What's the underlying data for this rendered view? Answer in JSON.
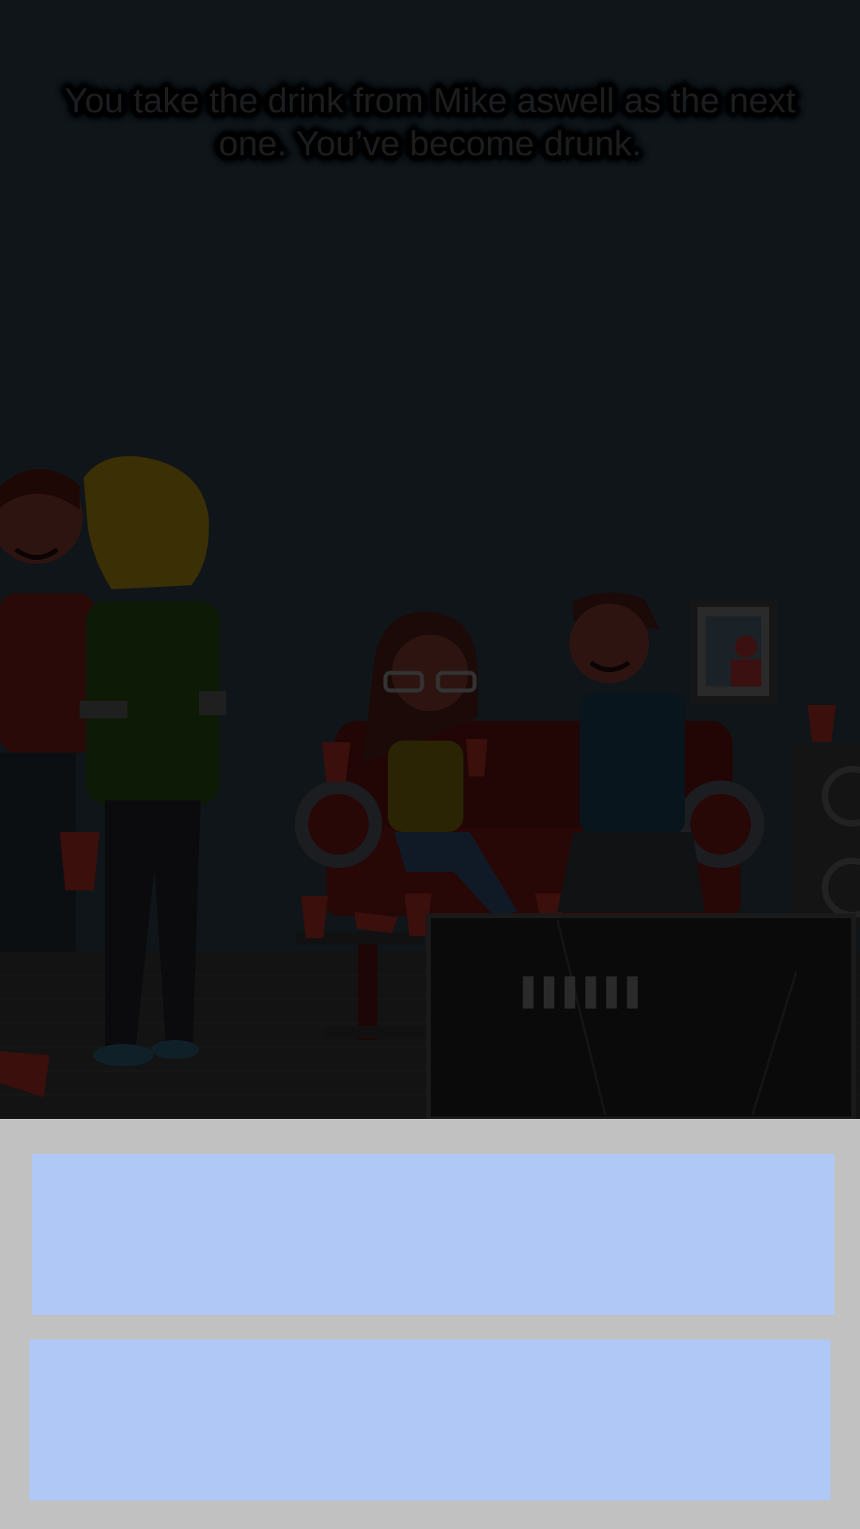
{
  "game": {
    "narration": "You take the drink from Mike aswell as the next one.  You’ve become drunk."
  },
  "choices": [
    {
      "label": ""
    },
    {
      "label": ""
    }
  ],
  "colors": {
    "background": "#0f1519",
    "panel": "#c1c1c1",
    "choice_button": "#b0c8f5"
  },
  "scene": {
    "setting": "house-party-living-room",
    "tv_screen_text": "▌▌▌▌▌▌"
  }
}
